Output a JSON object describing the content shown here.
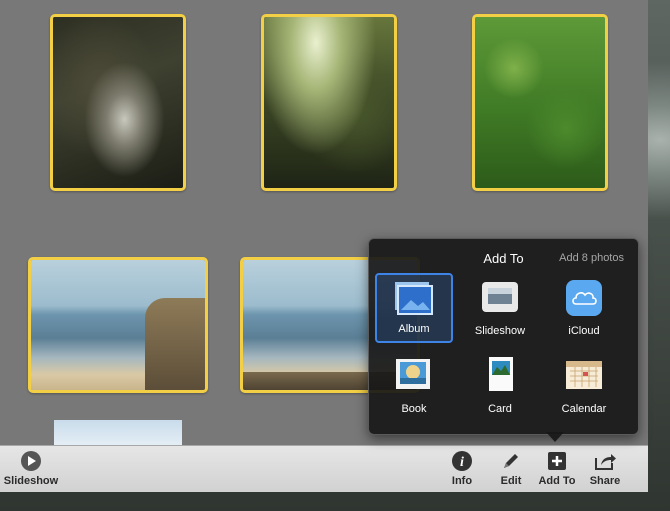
{
  "toolbar": {
    "slideshow_label": "Slideshow",
    "info_label": "Info",
    "edit_label": "Edit",
    "addto_label": "Add To",
    "share_label": "Share"
  },
  "popover": {
    "title": "Add To",
    "subtitle": "Add 8 photos",
    "items": [
      {
        "label": "Album",
        "icon": "album-icon",
        "selected": true
      },
      {
        "label": "Slideshow",
        "icon": "slideshow-icon"
      },
      {
        "label": "iCloud",
        "icon": "icloud-icon"
      },
      {
        "label": "Book",
        "icon": "book-icon"
      },
      {
        "label": "Card",
        "icon": "card-icon"
      },
      {
        "label": "Calendar",
        "icon": "calendar-icon"
      }
    ]
  },
  "colors": {
    "selection_border": "#f2cf45",
    "accent": "#3d84e6",
    "icloud": "#5aa9f0"
  }
}
